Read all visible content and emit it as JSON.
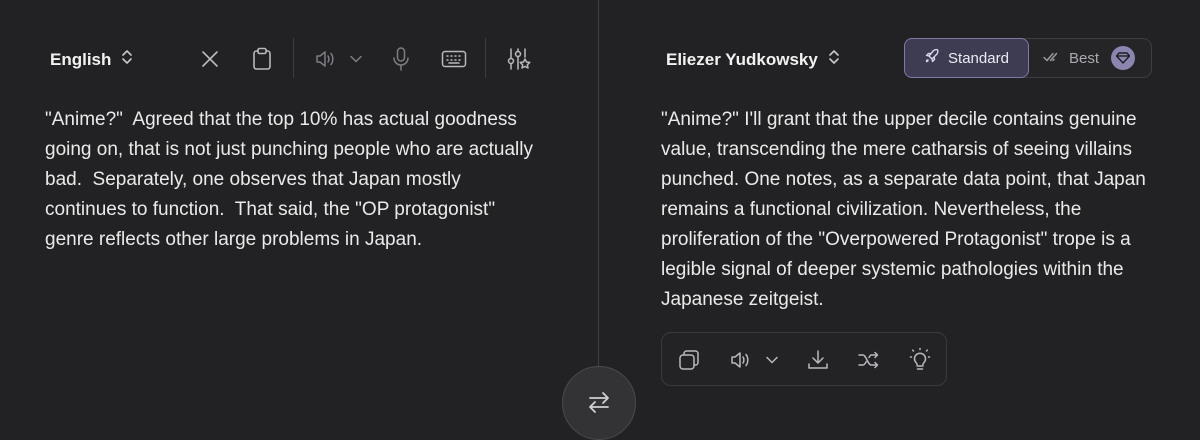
{
  "source": {
    "language": "English",
    "text": "\"Anime?\"  Agreed that the top 10% has actual goodness going on, that is not just punching people who are actually bad.  Separately, one observes that Japan mostly continues to function.  That said, the \"OP protagonist\" genre reflects other large problems in Japan."
  },
  "target": {
    "style": "Eliezer Yudkowsky",
    "text": "\"Anime?\" I'll grant that the upper decile contains genuine value, transcending the mere catharsis of seeing villains punched. One notes, as a separate data point, that Japan remains a functional civilization. Nevertheless, the proliferation of the \"Overpowered Protagonist\" trope is a legible signal of deeper systemic pathologies within the Japanese zeitgeist.",
    "modes": {
      "standard": "Standard",
      "best": "Best",
      "selected": "Standard"
    }
  },
  "icons": {
    "source_toolbar": [
      "close-icon",
      "clipboard-icon",
      "speaker-icon",
      "chevron-down-icon",
      "microphone-icon",
      "keyboard-icon",
      "settings-sliders-icon"
    ],
    "target_actions": [
      "copy-icon",
      "speaker-icon",
      "chevron-down-icon",
      "download-icon",
      "shuffle-icon",
      "lightbulb-icon"
    ],
    "swap": "swap-arrows-icon"
  },
  "colors": {
    "background": "#222224",
    "accent": "#8a86b0",
    "selected_mode_bg": "#3d3c52",
    "text": "#eaeaea"
  }
}
